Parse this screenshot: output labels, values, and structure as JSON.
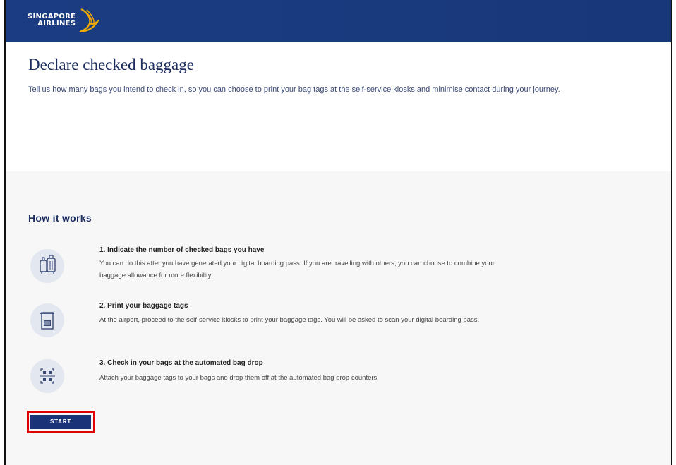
{
  "header": {
    "logo_line1": "SINGAPORE",
    "logo_line2": "AIRLINES",
    "bg_color": "#1a3a80",
    "logo_bird_color": "#f2a900"
  },
  "intro": {
    "title": "Declare checked baggage",
    "subtitle": "Tell us how many bags you intend to check in, so you can choose to print your bag tags at the self-service kiosks and minimise contact during your journey."
  },
  "how_it_works": {
    "title": "How it works",
    "steps": [
      {
        "icon": "luggage-icon",
        "title": "1. Indicate the number of checked bags you have",
        "desc_line1": "You can do this after you have generated your digital boarding pass. If you are travelling with others, you can choose to combine your",
        "desc_line2": "baggage allowance for more flexibility."
      },
      {
        "icon": "bag-tag-printer-icon",
        "title": "2. Print your baggage tags",
        "desc_line1": "At the airport, proceed to the self-service kiosks to print your baggage tags. You will be asked to scan your digital boarding pass."
      },
      {
        "icon": "qr-scan-icon",
        "title": "3. Check in your bags at the automated bag drop",
        "desc_line1": "Attach your baggage tags to your bags and drop them off at the automated bag drop counters."
      }
    ]
  },
  "actions": {
    "start_label": "START",
    "highlight_color": "#e00000"
  }
}
